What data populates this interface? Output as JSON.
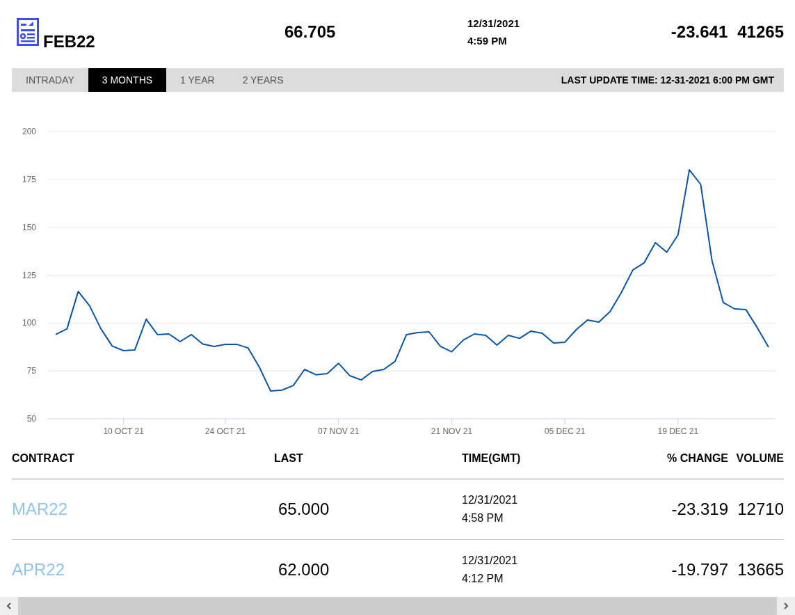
{
  "header": {
    "symbol": "FEB22",
    "last": "66.705",
    "date": "12/31/2021",
    "time": "4:59 PM",
    "change": "-23.641",
    "volume": "41265"
  },
  "tabs": [
    {
      "label": "INTRADAY",
      "selected": false
    },
    {
      "label": "3 MONTHS",
      "selected": true
    },
    {
      "label": "1 YEAR",
      "selected": false
    },
    {
      "label": "2 YEARS",
      "selected": false
    }
  ],
  "last_update": "LAST UPDATE TIME: 12-31-2021 6:00 PM GMT",
  "chart": {
    "chart_data": {
      "type": "line",
      "categories": [
        null,
        null,
        null,
        null,
        null,
        null,
        "10 OCT 21",
        null,
        null,
        null,
        null,
        null,
        null,
        null,
        null,
        "24 OCT 21",
        null,
        null,
        null,
        null,
        null,
        null,
        null,
        null,
        null,
        "07 NOV 21",
        null,
        null,
        null,
        null,
        null,
        null,
        null,
        null,
        null,
        "21 NOV 21",
        null,
        null,
        null,
        null,
        null,
        null,
        null,
        null,
        null,
        "05 DEC 21",
        null,
        null,
        null,
        null,
        null,
        null,
        null,
        null,
        null,
        "19 DEC 21",
        null,
        null,
        null,
        null,
        null,
        null,
        null,
        null
      ],
      "series": [
        {
          "color": "#0a55a3",
          "values": [
            94,
            97,
            116.5,
            109,
            97,
            88,
            85.6,
            86,
            102,
            94,
            94.3,
            90.3,
            94,
            89,
            87.8,
            88.9,
            88.9,
            87,
            77,
            64.5,
            65,
            67.4,
            75.8,
            73,
            73.6,
            79,
            72.5,
            70.3,
            74.7,
            75.8,
            80,
            94,
            95,
            95.4,
            87.8,
            85,
            91,
            94.3,
            93.6,
            88.5,
            93.6,
            92,
            95.8,
            94.7,
            89.6,
            90,
            96.5,
            101.6,
            100.5,
            106,
            116,
            127.7,
            131.4,
            142,
            137,
            146,
            180,
            172.4,
            132.5,
            110.7,
            107.4,
            107,
            97.6,
            87.4
          ]
        }
      ],
      "ylim": [
        50,
        200
      ],
      "grid": true,
      "yticks": [
        50,
        75,
        100,
        125,
        150,
        175,
        200
      ]
    }
  },
  "table": {
    "columns": [
      "CONTRACT",
      "LAST",
      "TIME(GMT)",
      "% CHANGE",
      "VOLUME"
    ],
    "rows": [
      {
        "contract": "MAR22",
        "last": "65.000",
        "date": "12/31/2021",
        "time": "4:58 PM",
        "change": "-23.319",
        "volume": "12710"
      },
      {
        "contract": "APR22",
        "last": "62.000",
        "date": "12/31/2021",
        "time": "4:12 PM",
        "change": "-19.797",
        "volume": "13665"
      }
    ]
  }
}
